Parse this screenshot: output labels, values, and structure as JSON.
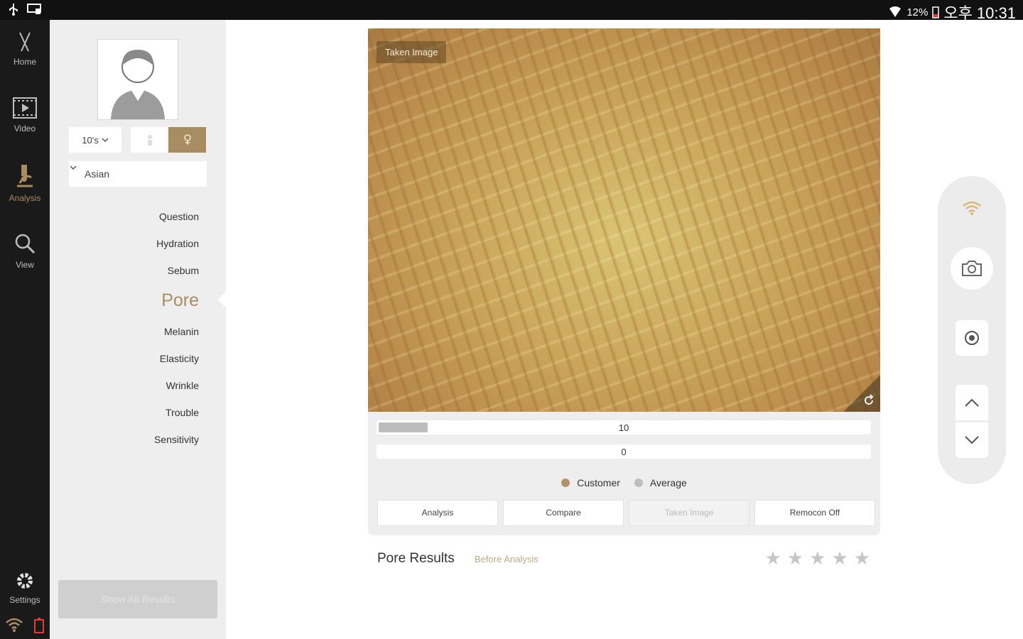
{
  "statusbar": {
    "battery_pct": "12%",
    "time": "오후 10:31"
  },
  "nav": {
    "home": "Home",
    "video": "Video",
    "analysis": "Analysis",
    "view": "View",
    "settings": "Settings"
  },
  "profile": {
    "age": "10's",
    "race": "Asian",
    "menu": {
      "question": "Question",
      "hydration": "Hydration",
      "sebum": "Sebum",
      "pore": "Pore",
      "melanin": "Melanin",
      "elasticity": "Elasticity",
      "wrinkle": "Wrinkle",
      "trouble": "Trouble",
      "sensitivity": "Sensitivity"
    },
    "show_all": "Show All Results"
  },
  "image": {
    "label": "Taken Image"
  },
  "bars": {
    "customer_value": "10",
    "customer_fill": 0.1,
    "average_value": "0",
    "average_fill": 0
  },
  "legend": {
    "customer": "Customer",
    "average": "Average"
  },
  "buttons": {
    "analysis": "Analysis",
    "compare": "Compare",
    "taken_image": "Taken Image",
    "remocon": "Remocon Off"
  },
  "results": {
    "title": "Pore Results",
    "status": "Before Analysis",
    "stars": [
      "★",
      "★",
      "★",
      "★",
      "★"
    ]
  },
  "colors": {
    "accent": "#a98d62",
    "customer_dot": "#b0936a",
    "average_dot": "#bdbdbd"
  }
}
